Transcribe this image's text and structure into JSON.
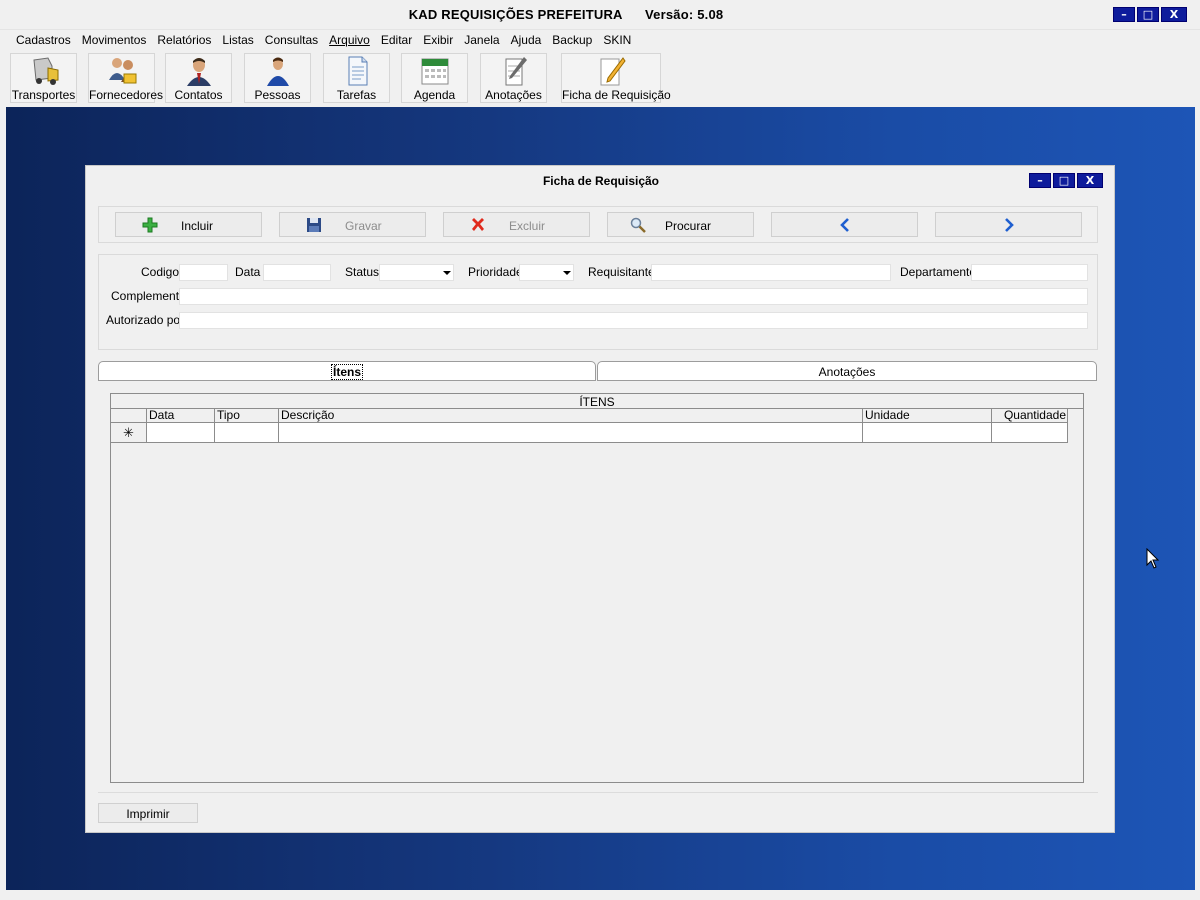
{
  "app": {
    "title": "KAD REQUISIÇÕES PREFEITURA      Versão: 5.08",
    "minimize": "–",
    "maximize": "□",
    "close": "X"
  },
  "menu": [
    "Cadastros",
    "Movimentos",
    "Relatórios",
    "Listas",
    "Consultas",
    "Arquivo",
    "Editar",
    "Exibir",
    "Janela",
    "Ajuda",
    "Backup",
    "SKIN"
  ],
  "toolbar": [
    {
      "label": "Transportes",
      "icon": "truck-icon"
    },
    {
      "label": "Fornecedores",
      "icon": "suppliers-icon"
    },
    {
      "label": "Contatos",
      "icon": "contact-person-icon"
    },
    {
      "label": "Pessoas",
      "icon": "person-icon"
    },
    {
      "label": "Tarefas",
      "icon": "document-icon"
    },
    {
      "label": "Agenda",
      "icon": "calendar-icon"
    },
    {
      "label": "Anotações",
      "icon": "notepad-icon"
    },
    {
      "label": "Ficha de Requisição",
      "icon": "pencil-note-icon"
    }
  ],
  "child": {
    "title": "Ficha de Requisição",
    "actions": {
      "incluir": "Incluir",
      "gravar": "Gravar",
      "excluir": "Excluir",
      "procurar": "Procurar"
    },
    "form": {
      "codigo": "Codigo",
      "data": "Data",
      "status": "Status",
      "prioridade": "Prioridade",
      "requisitante": "Requisitante",
      "departamento": "Departamento",
      "complemento": "Complemento",
      "autorizado": "Autorizado por"
    },
    "tabs": [
      "Ítens",
      "Anotações"
    ],
    "grid": {
      "title": "ÍTENS",
      "columns": [
        "Data",
        "Tipo",
        "Descrição",
        "Unidade",
        "Quantidade"
      ],
      "new_row_marker": "✳"
    },
    "print": "Imprimir"
  }
}
